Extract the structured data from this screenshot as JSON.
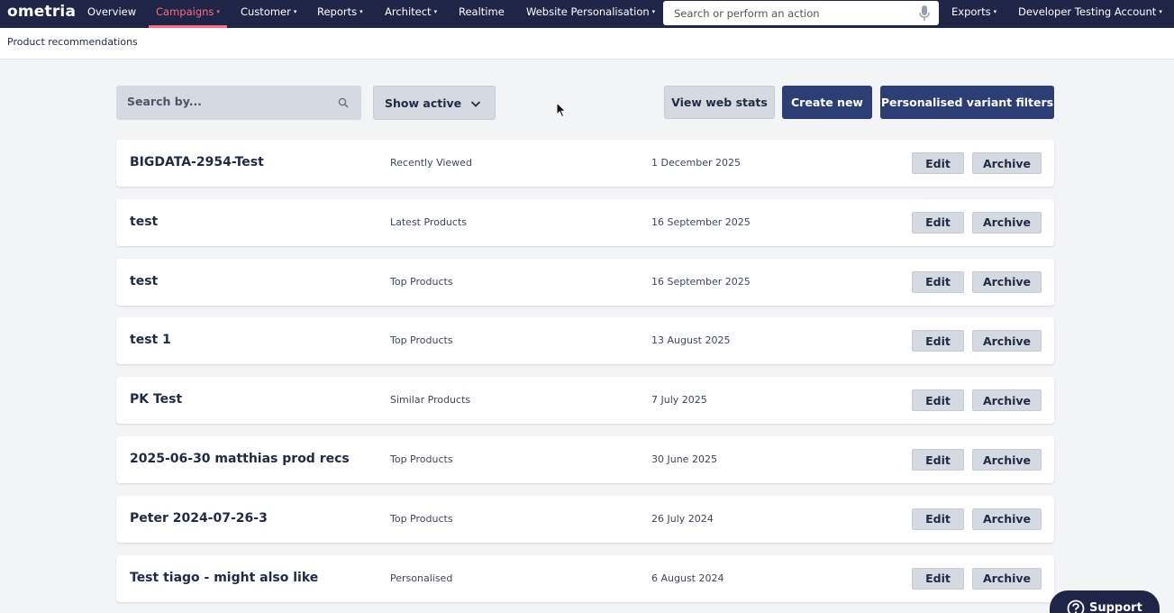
{
  "nav": {
    "logo": "ometria",
    "items": [
      {
        "label": "Overview",
        "caret": ""
      },
      {
        "label": "Campaigns",
        "caret": "▾"
      },
      {
        "label": "Customer",
        "caret": "▾"
      },
      {
        "label": "Reports",
        "caret": "▾"
      },
      {
        "label": "Architect",
        "caret": "▾"
      },
      {
        "label": "Realtime",
        "caret": ""
      },
      {
        "label": "Website Personalisation",
        "caret": "▾"
      }
    ],
    "active": "Campaigns",
    "search_placeholder": "Search or perform an action",
    "right_items": [
      {
        "label": "Exports",
        "caret": "▾"
      },
      {
        "label": "Developer Testing Account",
        "caret": "▾"
      }
    ],
    "colors": {
      "bar": "#1f2547",
      "active": "#ff6b86"
    }
  },
  "page": {
    "title": "Product recommendations"
  },
  "toolbar": {
    "search_placeholder": "Search by...",
    "filter_value": "Show active",
    "view_stats_label": "View web stats",
    "create_label": "Create new",
    "variant_filters_label": "Personalised variant filters"
  },
  "rows": [
    {
      "name": "BIGDATA-2954-Test",
      "type": "Recently Viewed",
      "date": "1 December 2025",
      "edit": "Edit",
      "archive": "Archive"
    },
    {
      "name": "test",
      "type": "Latest Products",
      "date": "16 September 2025",
      "edit": "Edit",
      "archive": "Archive"
    },
    {
      "name": "test",
      "type": "Top Products",
      "date": "16 September 2025",
      "edit": "Edit",
      "archive": "Archive"
    },
    {
      "name": "test 1",
      "type": "Top Products",
      "date": "13 August 2025",
      "edit": "Edit",
      "archive": "Archive"
    },
    {
      "name": "PK Test",
      "type": "Similar Products",
      "date": "7 July 2025",
      "edit": "Edit",
      "archive": "Archive"
    },
    {
      "name": "2025-06-30 matthias prod recs",
      "type": "Top Products",
      "date": "30 June 2025",
      "edit": "Edit",
      "archive": "Archive"
    },
    {
      "name": "Peter 2024-07-26-3",
      "type": "Top Products",
      "date": "26 July 2024",
      "edit": "Edit",
      "archive": "Archive"
    },
    {
      "name": "Test tiago - might also like",
      "type": "Personalised",
      "date": "6 August 2024",
      "edit": "Edit",
      "archive": "Archive"
    }
  ],
  "support": {
    "label": "Support",
    "icon": "question-circle-icon"
  }
}
